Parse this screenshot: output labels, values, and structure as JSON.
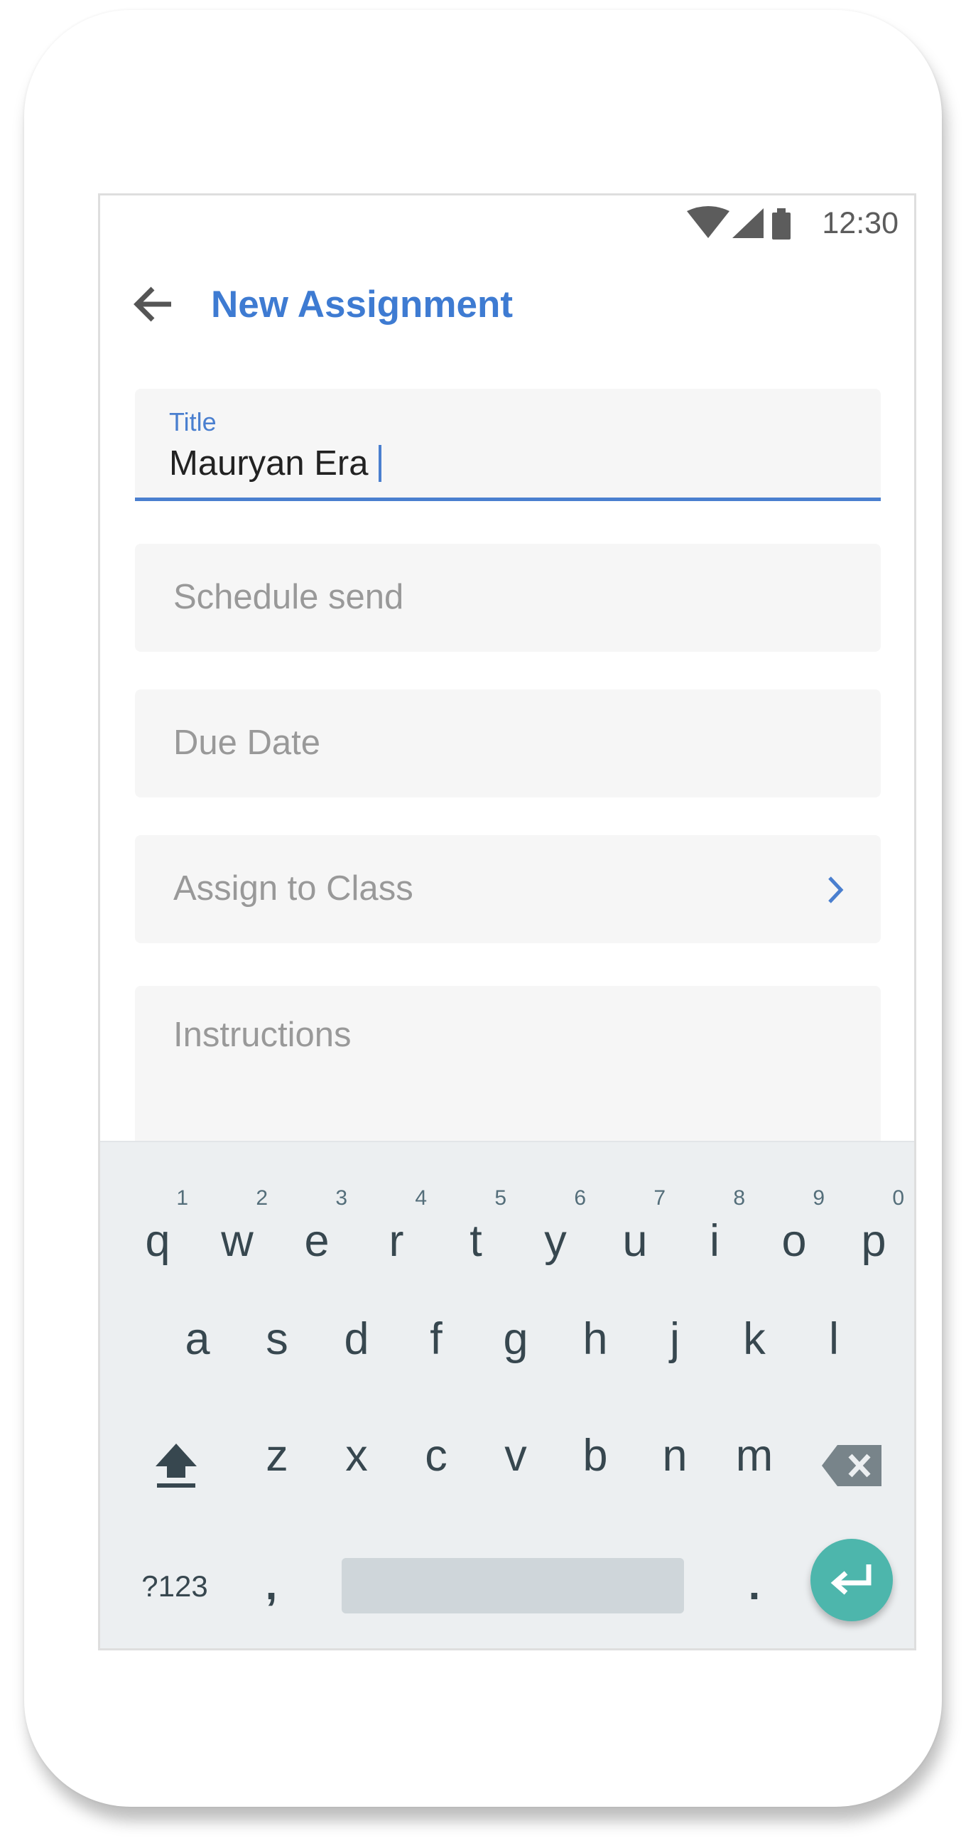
{
  "status_bar": {
    "time": "12:30",
    "icons": [
      "wifi-icon",
      "signal-icon",
      "battery-icon"
    ]
  },
  "app_bar": {
    "title": "New Assignment",
    "back_icon": "arrow-left-icon"
  },
  "form": {
    "title_label": "Title",
    "title_value": "Mauryan Era",
    "schedule_placeholder": "Schedule send",
    "due_date_placeholder": "Due Date",
    "assign_class_placeholder": "Assign to Class",
    "instructions_placeholder": "Instructions"
  },
  "keyboard": {
    "row1": [
      {
        "letter": "q",
        "hint": "1"
      },
      {
        "letter": "w",
        "hint": "2"
      },
      {
        "letter": "e",
        "hint": "3"
      },
      {
        "letter": "r",
        "hint": "4"
      },
      {
        "letter": "t",
        "hint": "5"
      },
      {
        "letter": "y",
        "hint": "6"
      },
      {
        "letter": "u",
        "hint": "7"
      },
      {
        "letter": "i",
        "hint": "8"
      },
      {
        "letter": "o",
        "hint": "9"
      },
      {
        "letter": "p",
        "hint": "0"
      }
    ],
    "row2": [
      "a",
      "s",
      "d",
      "f",
      "g",
      "h",
      "j",
      "k",
      "l"
    ],
    "row3": [
      "z",
      "x",
      "c",
      "v",
      "b",
      "n",
      "m"
    ],
    "symbols_label": "?123",
    "comma": ",",
    "period": ".",
    "shift_icon": "shift-icon",
    "backspace_icon": "backspace-icon",
    "enter_icon": "enter-icon"
  },
  "colors": {
    "accent": "#3e7bd2",
    "enter_key": "#4db6ac",
    "keyboard_bg": "#eceff1"
  }
}
